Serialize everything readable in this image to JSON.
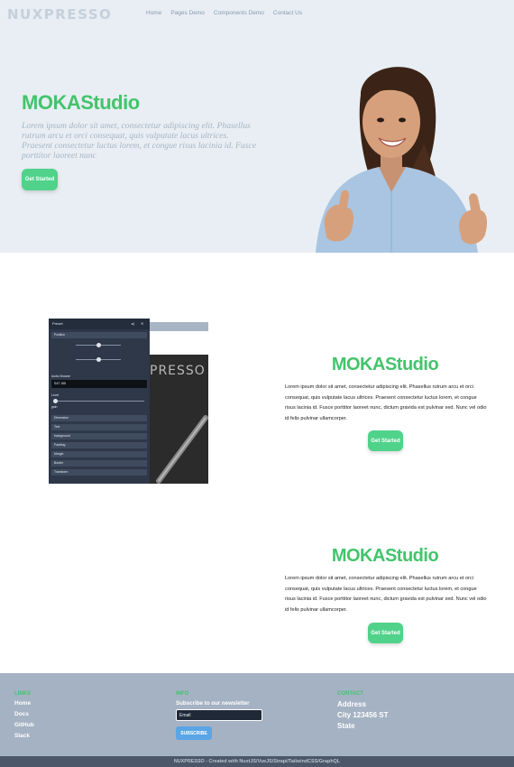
{
  "brand": "NUXPRESSO",
  "nav": {
    "items": [
      "Home",
      "Pages Demo",
      "Components Demo",
      "Contact Us"
    ]
  },
  "hero": {
    "title": "MOKAStudio",
    "text": "Lorem ipsum dolor sit amet, consectetur adipiscing elit. Phasellus rutrum arcu et orci consequat, quis vulputate lacus ultrices. Praesent consectetur luctus lorem, et congue risus lacinia id. Fusce porttitor laoreet nunc",
    "button": "Get Started"
  },
  "mock_panel": {
    "head": "Preset",
    "sub": "Position",
    "label1": "Audio Browse",
    "select_value": "SAT 188",
    "label2": "Level",
    "label3": "gain",
    "rows": [
      "Dimension",
      "Text",
      "background",
      "Padding",
      "Margin",
      "Border",
      "Transform"
    ],
    "photo_text": "PRESSO"
  },
  "features": [
    {
      "title": "MOKAStudio",
      "text": "Lorem ipsum dolor sit amet, consectetur adipiscing elit. Phasellus rutrum arcu et orci consequat, quis vulputate lacus ultrices. Praesent consectetur luctus lorem, et congue risus lacinia id. Fusce porttitor laoreet nunc, dictum gravida est pulvinar sed. Nunc vel odio id felis pulvinar ullamcorper.",
      "button": "Get Started"
    },
    {
      "title": "MOKAStudio",
      "text": "Lorem ipsum dolor sit amet, consectetur adipiscing elit. Phasellus rutrum arcu et orci consequat, quis vulputate lacus ultrices. Praesent consectetur luctus lorem, et congue risus lacinia id. Fusce porttitor laoreet nunc, dictum gravida est pulvinar sed. Nunc vel odio id felis pulvinar ullamcorper.",
      "button": "Get Started"
    }
  ],
  "footer": {
    "links_title": "LINKS",
    "links": [
      "Home",
      "Docs",
      "GitHub",
      "Slack"
    ],
    "info_title": "INFO",
    "newsletter_label": "Subscribe to our newsletter",
    "email_placeholder": "Email",
    "subscribe": "SUBSCRIBE",
    "contact_title": "CONTACT",
    "contact_lines": [
      "Address",
      "City 123456 ST",
      "State"
    ],
    "credit": "NUXPRESSO - Created with NuxtJS/VueJS/Strapi/TailwindCSS/GraphQL"
  },
  "colors": {
    "accent_green": "#43c46c",
    "button_green": "#50d28a",
    "hero_bg": "#e8eef3",
    "footer_bg": "#a5b2c3",
    "subscribe_blue": "#5aa5e6"
  }
}
